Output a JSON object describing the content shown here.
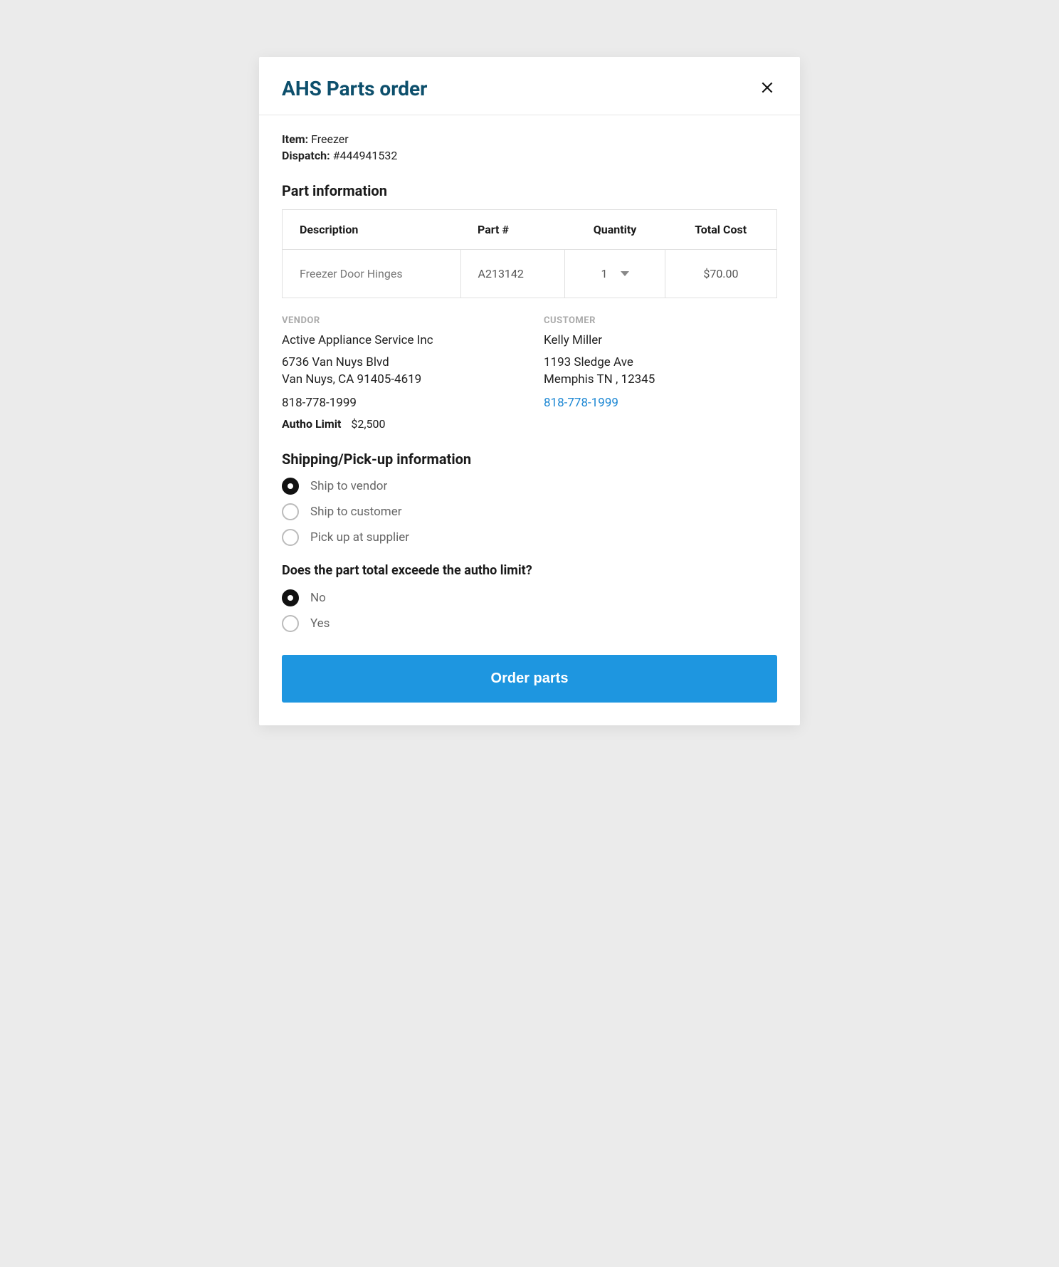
{
  "modal": {
    "title": "AHS Parts order"
  },
  "meta": {
    "item_label": "Item:",
    "item_value": " Freezer",
    "dispatch_label": "Dispatch:",
    "dispatch_value": " #444941532"
  },
  "part_info": {
    "section_title": "Part information",
    "headers": {
      "description": "Description",
      "part_number": "Part #",
      "quantity": "Quantity",
      "total_cost": "Total Cost"
    },
    "row": {
      "description": "Freezer Door Hinges",
      "part_number": "A213142",
      "quantity": "1",
      "total_cost": "$70.00"
    }
  },
  "vendor": {
    "label": "VENDOR",
    "name": "Active Appliance Service Inc",
    "address_line1": "6736 Van Nuys Blvd",
    "address_line2": "Van Nuys, CA 91405-4619",
    "phone": "818-778-1999",
    "autho_label": "Autho Limit",
    "autho_value": "$2,500"
  },
  "customer": {
    "label": "CUSTOMER",
    "name": "Kelly Miller",
    "address_line1": "1193 Sledge Ave",
    "address_line2": "Memphis TN , 12345",
    "phone": "818-778-1999"
  },
  "shipping": {
    "section_title": "Shipping/Pick-up information",
    "options": {
      "ship_vendor": "Ship to vendor",
      "ship_customer": "Ship to customer",
      "pickup_supplier": "Pick up at supplier"
    }
  },
  "exceed": {
    "question": "Does the part total exceede the autho limit?",
    "no": "No",
    "yes": "Yes"
  },
  "actions": {
    "order": "Order parts"
  }
}
